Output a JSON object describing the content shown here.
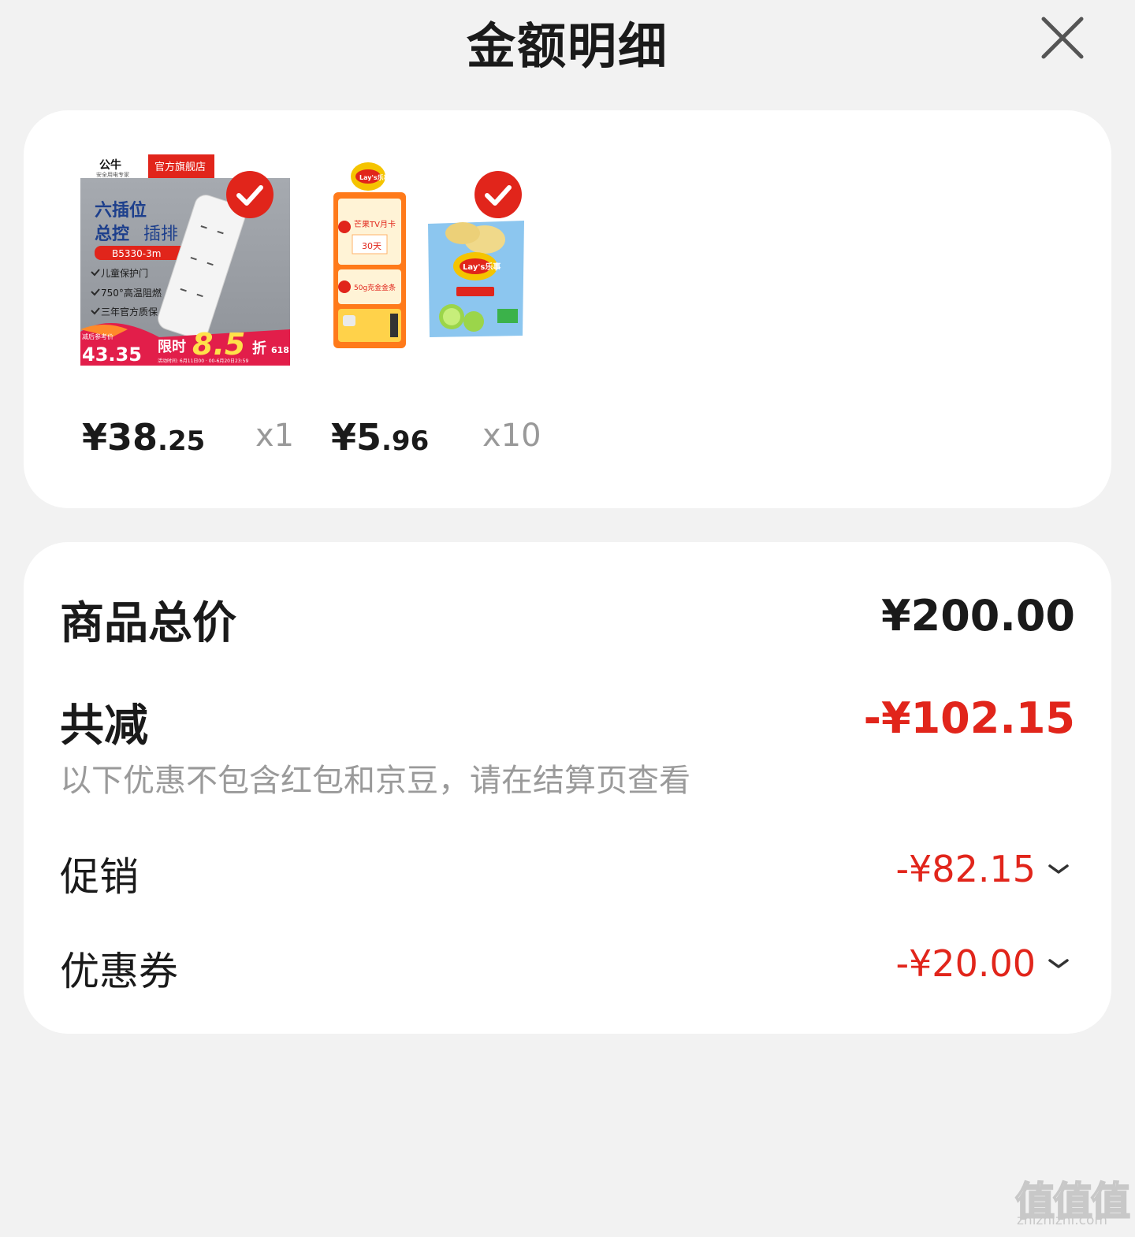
{
  "header": {
    "title": "金额明细",
    "close_icon": "close-icon"
  },
  "products": [
    {
      "image_icon": "power-strip-product-image",
      "image_text": {
        "brand": "公牛",
        "brand_tag": "安全用电专家",
        "store_tag": "官方旗舰店",
        "line1": "六插位",
        "line2": "总控",
        "line2b": "插排",
        "model": "B5330-3m",
        "features": [
          "儿童保护门",
          "750°高温阻燃",
          "三年官方质保"
        ],
        "ref_label": "减后参考价",
        "ref_price": "43.35",
        "promo_prefix": "限时",
        "promo_discount": "8.5",
        "promo_suffix": "折",
        "promo_618": "618",
        "promo_time": "活动时间: 6月11日00 · 00-6月20日23:59"
      },
      "selected": true,
      "price_main": "¥38",
      "price_cents": ".25",
      "quantity": "x1"
    },
    {
      "image_icon": "lays-chips-product-image",
      "image_text": {
        "brand": "Lay's乐事",
        "poster_line1": "芒果TV月卡",
        "poster_days": "30天",
        "poster_line2": "50g克金金条",
        "bag_brand": "Lay's乐事"
      },
      "selected": true,
      "price_main": "¥5",
      "price_cents": ".96",
      "quantity": "x10"
    }
  ],
  "summary": {
    "total_label": "商品总价",
    "total_value": "¥200.00",
    "discount_label": "共减",
    "discount_value": "-¥102.15",
    "note": "以下优惠不包含红包和京豆，请在结算页查看",
    "promo_label": "促销",
    "promo_value": "-¥82.15",
    "coupon_label": "优惠券",
    "coupon_value": "-¥20.00"
  },
  "watermark": {
    "logo": "值值值",
    "url": "zhizhizhi.com"
  },
  "colors": {
    "accent_red": "#e1251b",
    "background": "#f2f2f2",
    "card": "#ffffff",
    "muted_text": "#999999"
  }
}
